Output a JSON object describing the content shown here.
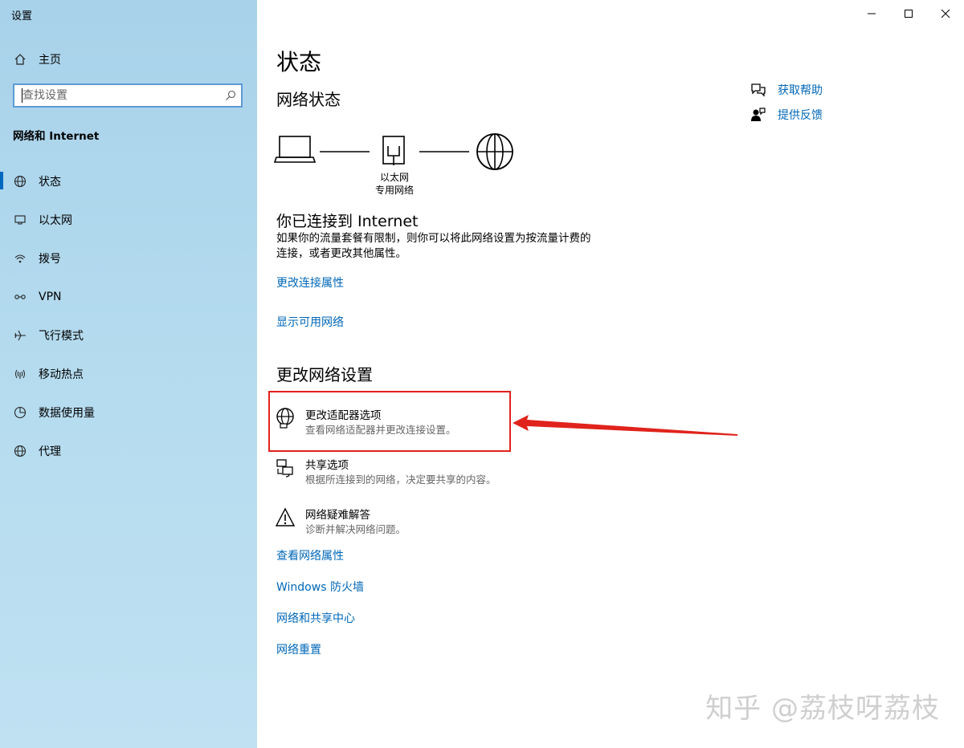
{
  "window": {
    "title": "设置"
  },
  "sidebar": {
    "home_label": "主页",
    "search_placeholder": "查找设置",
    "section_title": "网络和 Internet",
    "items": [
      {
        "label": "状态",
        "icon": "globe-status-icon",
        "active": true
      },
      {
        "label": "以太网",
        "icon": "ethernet-icon"
      },
      {
        "label": "拨号",
        "icon": "dialup-icon"
      },
      {
        "label": "VPN",
        "icon": "vpn-icon"
      },
      {
        "label": "飞行模式",
        "icon": "airplane-icon"
      },
      {
        "label": "移动热点",
        "icon": "hotspot-icon"
      },
      {
        "label": "数据使用量",
        "icon": "data-usage-icon"
      },
      {
        "label": "代理",
        "icon": "proxy-globe-icon"
      }
    ]
  },
  "main": {
    "title": "状态",
    "network_status_heading": "网络状态",
    "diagram": {
      "label_line1": "以太网",
      "label_line2": "专用网络"
    },
    "connected_heading": "你已连接到 Internet",
    "connected_text_line1": "如果你的流量套餐有限制，则你可以将此网络设置为按流量计费的",
    "connected_text_line2": "连接，或者更改其他属性。",
    "link_change_props": "更改连接属性",
    "link_show_networks": "显示可用网络",
    "change_settings_heading": "更改网络设置",
    "options": [
      {
        "title": "更改适配器选项",
        "desc": "查看网络适配器并更改连接设置。",
        "icon": "adapter-globe-icon"
      },
      {
        "title": "共享选项",
        "desc": "根据所连接到的网络，决定要共享的内容。",
        "icon": "sharing-icon"
      },
      {
        "title": "网络疑难解答",
        "desc": "诊断并解决网络问题。",
        "icon": "warning-icon"
      }
    ],
    "bottom_links": [
      "查看网络属性",
      "Windows 防火墙",
      "网络和共享中心",
      "网络重置"
    ]
  },
  "help": {
    "get_help": "获取帮助",
    "feedback": "提供反馈"
  },
  "watermark": "知乎 @荔枝呀荔枝",
  "colors": {
    "accent": "#0067b8",
    "highlight": "#e0231c",
    "sidebar": "#b6dcef"
  }
}
